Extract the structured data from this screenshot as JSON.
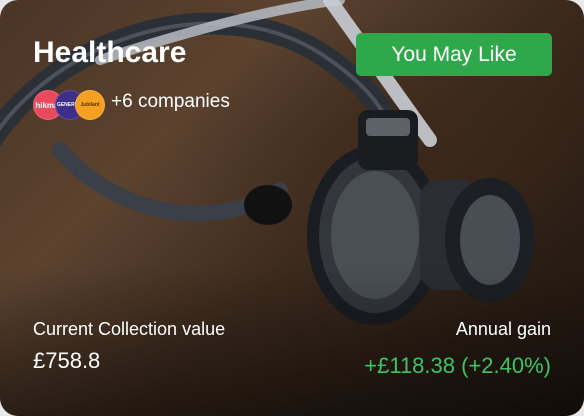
{
  "card": {
    "title": "Healthcare",
    "cta_label": "You May Like",
    "logos": [
      "hikma.",
      "GENERICS",
      "Jubilant"
    ],
    "companies_text": "+6 companies",
    "collection_label": "Current Collection value",
    "collection_value": "£758.8",
    "gain_label": "Annual gain",
    "gain_value": "+£118.38 (+2.40%)"
  },
  "colors": {
    "accent_green": "#2ea84a",
    "gain_green": "#3ec462"
  },
  "icons": {
    "background": "stethoscope-image"
  }
}
